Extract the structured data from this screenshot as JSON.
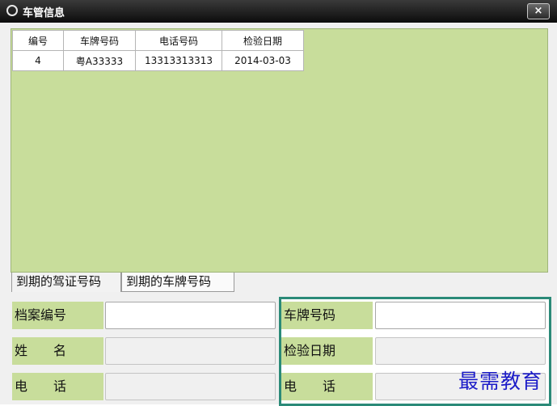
{
  "window": {
    "title": "车管信息",
    "close_label": "×"
  },
  "grid": {
    "columns": [
      "编号",
      "车牌号码",
      "电话号码",
      "检验日期"
    ],
    "rows": [
      [
        "4",
        "粤A33333",
        "13313313313",
        "2014-03-03"
      ]
    ]
  },
  "tabs": [
    {
      "label": "到期的驾证号码",
      "active": true
    },
    {
      "label": "到期的车牌号码",
      "active": false
    }
  ],
  "left_form": {
    "archive_no_label": "档案编号",
    "archive_no_value": "",
    "name_label": "姓　　名",
    "name_value": "",
    "phone_label": "电　　话",
    "phone_value": ""
  },
  "right_form": {
    "plate_label": "车牌号码",
    "plate_value": "",
    "inspect_date_label": "检验日期",
    "inspect_date_value": "",
    "phone_label": "电　　话",
    "phone_value": ""
  },
  "watermark": "最需教育",
  "colors": {
    "grid_background": "#c8dd9b",
    "label_background": "#c8dd9b",
    "panel_border": "#2b8a78",
    "watermark": "#1d1dc8"
  }
}
